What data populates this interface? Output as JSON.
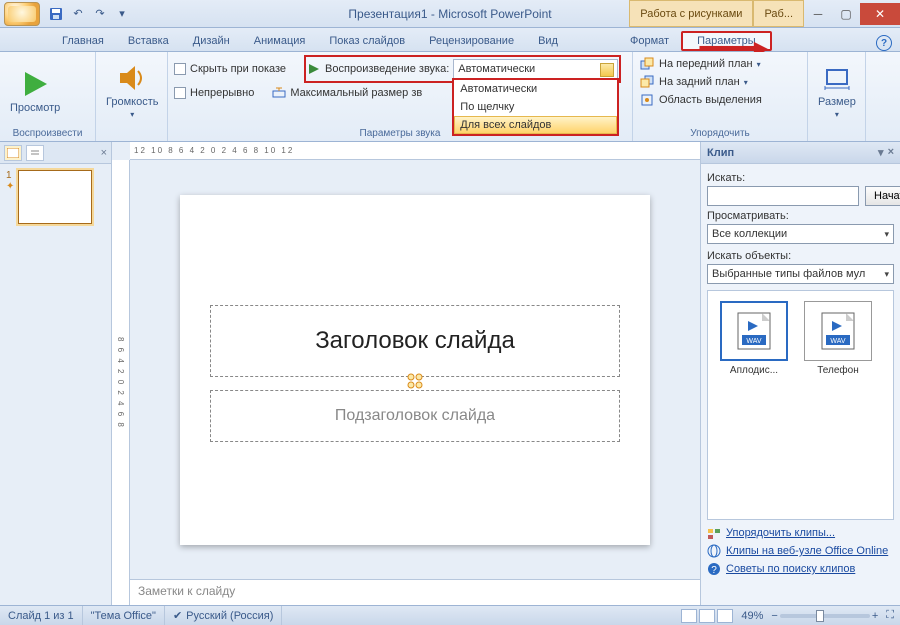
{
  "titlebar": {
    "title": "Презентация1 - Microsoft PowerPoint",
    "context_tabs": [
      "Работа с рисунками",
      "Раб..."
    ],
    "qat_tips": [
      "save",
      "undo",
      "redo",
      "customize"
    ]
  },
  "tabs": {
    "items": [
      "Главная",
      "Вставка",
      "Дизайн",
      "Анимация",
      "Показ слайдов",
      "Рецензирование",
      "Вид",
      "Формат",
      "Параметры"
    ],
    "active_index": 8,
    "highlight_index": 8
  },
  "ribbon": {
    "play": {
      "preview": "Просмотр",
      "group": "Воспроизвести"
    },
    "volume": {
      "label": "Громкость"
    },
    "options": {
      "hide": "Скрыть при показе",
      "loop": "Непрерывно",
      "play_label": "Воспроизведение звука:",
      "max_size": "Максимальный размер зв",
      "combo_selected": "Автоматически",
      "combo_options": [
        "Автоматически",
        "По щелчку",
        "Для всех слайдов"
      ],
      "combo_hover_index": 2,
      "group": "Параметры звука"
    },
    "arrange": {
      "front": "На передний план",
      "back": "На задний план",
      "selpane": "Область выделения",
      "group": "Упорядочить"
    },
    "size": {
      "label": "Размер"
    }
  },
  "slide": {
    "title_ph": "Заголовок слайда",
    "sub_ph": "Подзаголовок слайда",
    "notes_ph": "Заметки к слайду",
    "ruler": "12  10  8  6  4  2  0  2  4  6  8  10  12"
  },
  "clip": {
    "header": "Клип",
    "search_label": "Искать:",
    "search_btn": "Начать",
    "browse_label": "Просматривать:",
    "browse_value": "Все коллекции",
    "types_label": "Искать объекты:",
    "types_value": "Выбранные типы файлов мул",
    "results": [
      {
        "name": "Аплодис...",
        "selected": true
      },
      {
        "name": "Телефон",
        "selected": false
      }
    ],
    "links": [
      "Упорядочить клипы...",
      "Клипы на веб-узле Office Online",
      "Советы по поиску клипов"
    ]
  },
  "status": {
    "slide": "Слайд 1 из 1",
    "theme": "\"Тема Office\"",
    "lang": "Русский (Россия)",
    "zoom": "49%"
  }
}
